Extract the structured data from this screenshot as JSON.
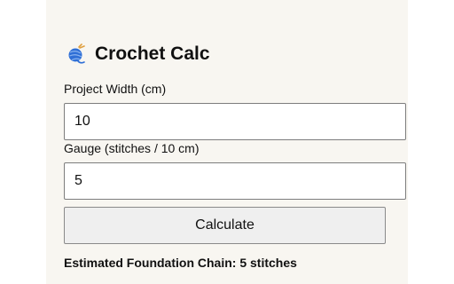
{
  "app": {
    "title": "Crochet Calc",
    "icon": "yarn-ball-icon"
  },
  "form": {
    "width_label": "Project Width (cm)",
    "width_value": "10",
    "gauge_label": "Gauge (stitches / 10 cm)",
    "gauge_value": "5",
    "calculate_label": "Calculate"
  },
  "result": {
    "text": "Estimated Foundation Chain: 5 stitches"
  },
  "colors": {
    "panel_background": "#f8f6f1",
    "yarn_blue": "#2f6fd6",
    "button_background": "#efefef"
  }
}
